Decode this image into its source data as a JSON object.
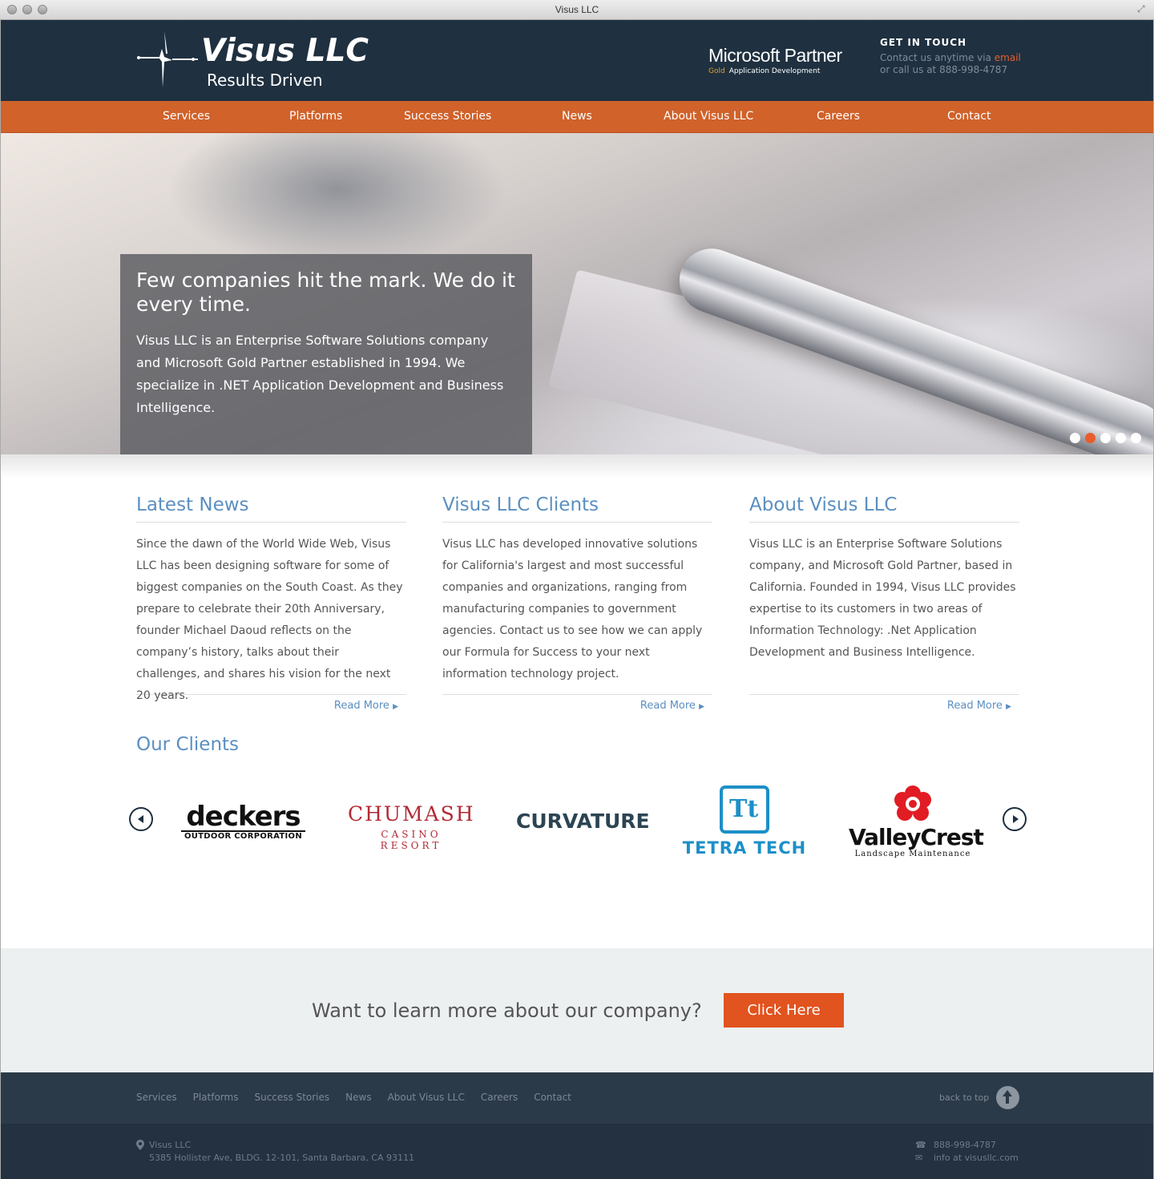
{
  "window": {
    "title": "Visus LLC"
  },
  "header": {
    "logo_title": "Visus LLC",
    "logo_tagline": "Results Driven",
    "partner_title": "Microsoft Partner",
    "partner_gold": "Gold",
    "partner_sub": "Application Development",
    "contact_heading": "GET IN TOUCH",
    "contact_line1_prefix": "Contact us anytime via",
    "contact_email_label": "email",
    "contact_line2": "or call us at 888-998-4787"
  },
  "nav": {
    "items": [
      "Services",
      "Platforms",
      "Success Stories",
      "News",
      "About Visus LLC",
      "Careers",
      "Contact"
    ]
  },
  "hero": {
    "headline": "Few companies hit the mark. We do it every time.",
    "body": "Visus LLC is an Enterprise Software Solutions company and Microsoft Gold Partner established in 1994. We specialize in .NET Application Development and Business Intelligence.",
    "slides_total": 5,
    "active_slide": 2
  },
  "columns": [
    {
      "title": "Latest News",
      "text": "Since the dawn of the World Wide Web, Visus LLC has been designing software for some of biggest companies on the South Coast. As they prepare to celebrate their 20th Anniversary, founder Michael Daoud reflects on the company’s history, talks about their challenges, and shares his vision for the next 20 years.",
      "link": "Read More"
    },
    {
      "title": "Visus LLC Clients",
      "text": "Visus LLC has developed innovative solutions for California's largest and most successful companies and organizations, ranging from manufacturing companies to government agencies. Contact us to see how we can apply our Formula for Success to your next information technology project.",
      "link": "Read More"
    },
    {
      "title": "About Visus LLC",
      "text": "Visus LLC is an Enterprise Software Solutions company, and Microsoft Gold Partner, based in California. Founded in 1994, Visus LLC provides expertise to its customers in two areas of Information Technology: .Net Application Development and Business Intelligence.",
      "link": "Read More"
    }
  ],
  "clients": {
    "title": "Our Clients",
    "logos": [
      {
        "name": "deckers",
        "sub": "OUTDOOR CORPORATION"
      },
      {
        "name": "CHUMASH",
        "sub": "CASINO RESORT"
      },
      {
        "name": "CURVATURE"
      },
      {
        "name": "TETRA TECH",
        "mark": "Tt"
      },
      {
        "name": "ValleyCrest",
        "sub": "Landscape Maintenance"
      }
    ]
  },
  "cta": {
    "text": "Want to learn more about our company?",
    "button": "Click Here"
  },
  "footer": {
    "nav": [
      "Services",
      "Platforms",
      "Success Stories",
      "News",
      "About Visus LLC",
      "Careers",
      "Contact"
    ],
    "back_to_top": "back to top",
    "company": "Visus LLC",
    "address": "5385 Hollister Ave, BLDG. 12-101, Santa Barbara, CA 93111",
    "phone": "888-998-4787",
    "email": "info at visusllc.com"
  },
  "colors": {
    "header_bg": "#1f3040",
    "nav_bg": "#d0622a",
    "accent": "#e1531f",
    "heading_blue": "#5b8fc0",
    "footer_bg": "#2b3a48"
  },
  "icons": [
    "visus-logo-icon",
    "map-pin-icon",
    "phone-icon",
    "envelope-icon",
    "arrow-up-icon",
    "chevron-left-icon",
    "chevron-right-icon"
  ]
}
